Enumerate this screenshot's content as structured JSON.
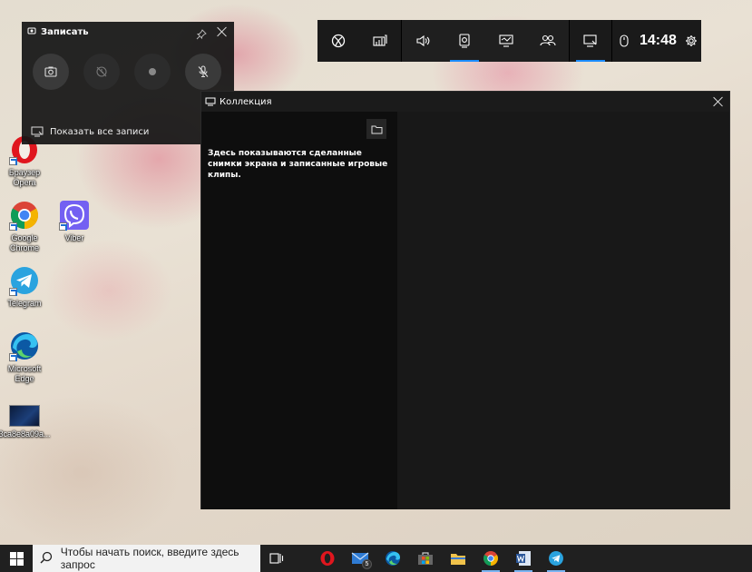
{
  "desktop": {
    "icons": [
      {
        "label": "Браузер Opera",
        "name": "opera"
      },
      {
        "label": "Google Chrome",
        "name": "chrome"
      },
      {
        "label": "Viber",
        "name": "viber"
      },
      {
        "label": "Telegram",
        "name": "telegram"
      },
      {
        "label": "Microsoft Edge",
        "name": "edge"
      },
      {
        "label": "3ca8e8a09a...",
        "name": "image-file"
      }
    ]
  },
  "capture_widget": {
    "title": "Записать",
    "show_all_label": "Показать все записи"
  },
  "game_bar": {
    "time": "14:48"
  },
  "gallery": {
    "title": "Коллекция",
    "empty_message": "Здесь показываются сделанные снимки экрана и записанные игровые клипы."
  },
  "taskbar": {
    "search_placeholder": "Чтобы начать поиск, введите здесь запрос",
    "mail_badge": "5"
  },
  "colors": {
    "accent": "#1a8cff",
    "widget_bg": "#161616",
    "taskbar_bg": "#202020"
  }
}
